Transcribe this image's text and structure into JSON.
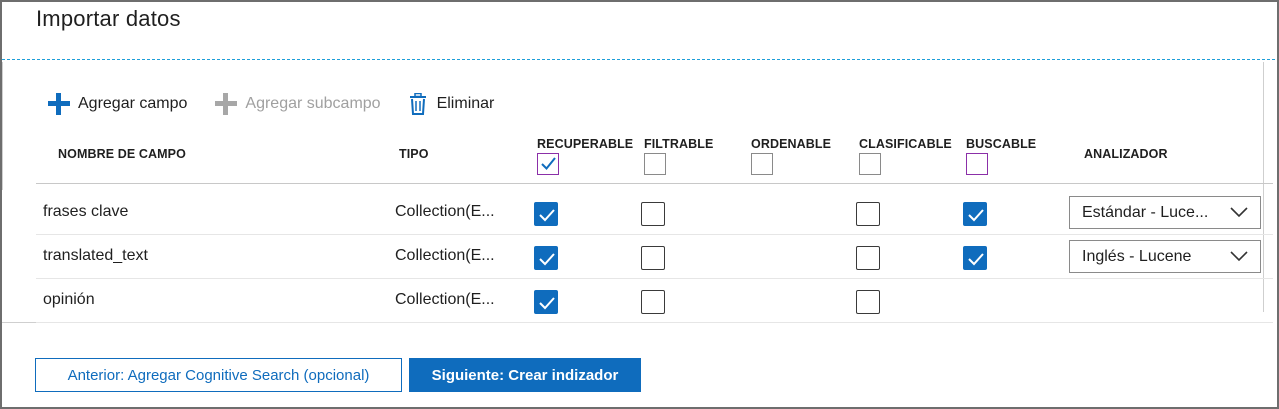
{
  "title": "Importar datos",
  "toolbar": {
    "add_field": "Agregar campo",
    "add_subfield": "Agregar subcampo",
    "delete": "Eliminar"
  },
  "columns": {
    "name": "NOMBRE DE CAMPO",
    "type": "TIPO",
    "retrievable": "RECUPERABLE",
    "filterable": "FILTRABLE",
    "sortable": "ORDENABLE",
    "facetable": "CLASIFICABLE",
    "searchable": "BUSCABLE",
    "analyzer": "ANALIZADOR"
  },
  "header_checkboxes": {
    "retrievable": true,
    "filterable": false,
    "sortable": false,
    "facetable": false,
    "searchable": false
  },
  "rows": [
    {
      "name": "frases clave",
      "type": "Collection(E...",
      "retrievable": true,
      "filterable": false,
      "facetable": false,
      "searchable": true,
      "analyzer": "Estándar - Luce..."
    },
    {
      "name": "translated_text",
      "type": "Collection(E...",
      "retrievable": true,
      "filterable": false,
      "facetable": false,
      "searchable": true,
      "analyzer": "Inglés - Lucene"
    },
    {
      "name": "opinión",
      "type": "Collection(E...",
      "retrievable": true,
      "filterable": false,
      "facetable": false
    }
  ],
  "buttons": {
    "previous": "Anterior: Agregar Cognitive Search (opcional)",
    "next": "Siguiente: Crear indizador"
  },
  "colors": {
    "accent": "#0f6cbd",
    "dashed_divider": "#1e9fd9",
    "header_checkbox_focus": "#8b2fa8"
  },
  "icons": {
    "add_field": "plus-icon",
    "add_subfield": "plus-icon",
    "delete": "trash-icon",
    "checkbox": "checkmark-icon",
    "select": "chevron-down-icon"
  }
}
